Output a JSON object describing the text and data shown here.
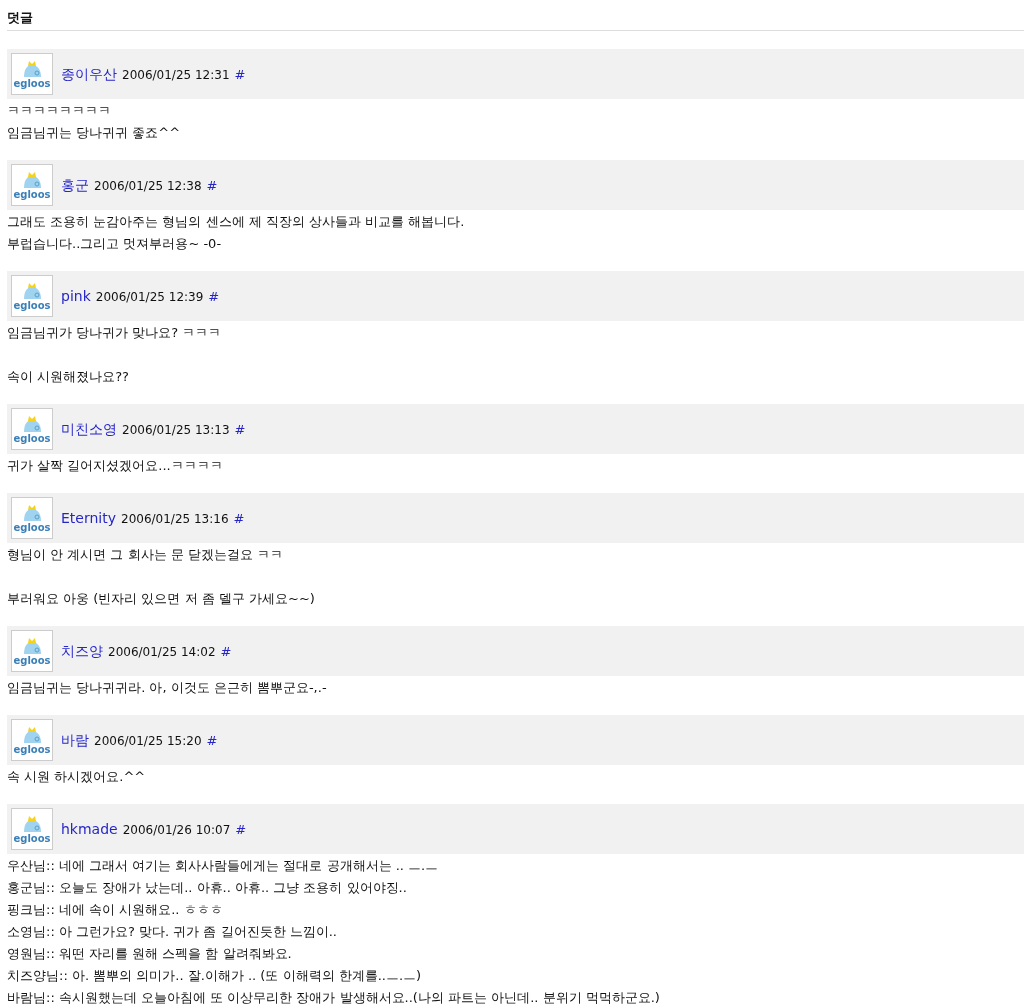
{
  "heading": "덧글",
  "comments": [
    {
      "author": "종이우산",
      "date": "2006/01/25 12:31",
      "permalink": "#",
      "avatar_text": "egloos",
      "paragraphs": [
        [
          "ㅋㅋㅋㅋㅋㅋㅋㅋ",
          "임금님귀는 당나귀귀 좋죠^^"
        ]
      ]
    },
    {
      "author": "홍군",
      "date": "2006/01/25 12:38",
      "permalink": "#",
      "avatar_text": "egloos",
      "paragraphs": [
        [
          "그래도 조용히 눈감아주는 형님의 센스에 제 직장의 상사들과 비교를 해봅니다.",
          "부럽습니다..그리고 멋져부러용~ -0-"
        ]
      ]
    },
    {
      "author": "pink",
      "date": "2006/01/25 12:39",
      "permalink": "#",
      "avatar_text": "egloos",
      "paragraphs": [
        [
          "임금님귀가 당나귀가 맞나요? ㅋㅋㅋ"
        ],
        [
          "속이 시원해졌나요??"
        ]
      ]
    },
    {
      "author": "미친소영",
      "date": "2006/01/25 13:13",
      "permalink": "#",
      "avatar_text": "egloos",
      "paragraphs": [
        [
          "귀가 살짝 길어지셨겠어요...ㅋㅋㅋㅋ"
        ]
      ]
    },
    {
      "author": "Eternity",
      "date": "2006/01/25 13:16",
      "permalink": "#",
      "avatar_text": "egloos",
      "paragraphs": [
        [
          "형님이 안 계시면 그 회사는 문 닫겠는걸요 ㅋㅋ"
        ],
        [
          "부러워요 아웅 (빈자리 있으면 저 좀 델구 가세요~~)"
        ]
      ]
    },
    {
      "author": "치즈양",
      "date": "2006/01/25 14:02",
      "permalink": "#",
      "avatar_text": "egloos",
      "paragraphs": [
        [
          "임금님귀는 당나귀귀라. 아, 이것도 은근히 뽐뿌군요-,.-"
        ]
      ]
    },
    {
      "author": "바람",
      "date": "2006/01/25 15:20",
      "permalink": "#",
      "avatar_text": "egloos",
      "paragraphs": [
        [
          "속 시원 하시겠어요.^^"
        ]
      ]
    },
    {
      "author": "hkmade",
      "date": "2006/01/26 10:07",
      "permalink": "#",
      "avatar_text": "egloos",
      "paragraphs": [
        [
          "우산님:: 네에 그래서 여기는 회사사람들에게는 절대로 공개해서는 .. ㅡ.ㅡ",
          "홍군님:: 오늘도 장애가 났는데.. 아휴.. 아휴.. 그냥 조용히 있어야징..",
          "핑크님:: 네에 속이 시원해요.. ㅎㅎㅎ",
          "소영님:: 아 그런가요? 맞다. 귀가 좀 길어진듯한 느낌이..",
          "영원님:: 워떤 자리를 원해 스펙을 함 알려줘봐요.",
          "치즈양님:: 아. 뽐뿌의 의미가.. 잘.이해가 .. (또 이해력의 한계를..ㅡ.ㅡ)",
          "바람님:: 속시원했는데 오늘아침에 또 이상무리한 장애가 발생해서요..(나의 파트는 아닌데.. 분위기 먹먹하군요.)"
        ]
      ]
    }
  ]
}
